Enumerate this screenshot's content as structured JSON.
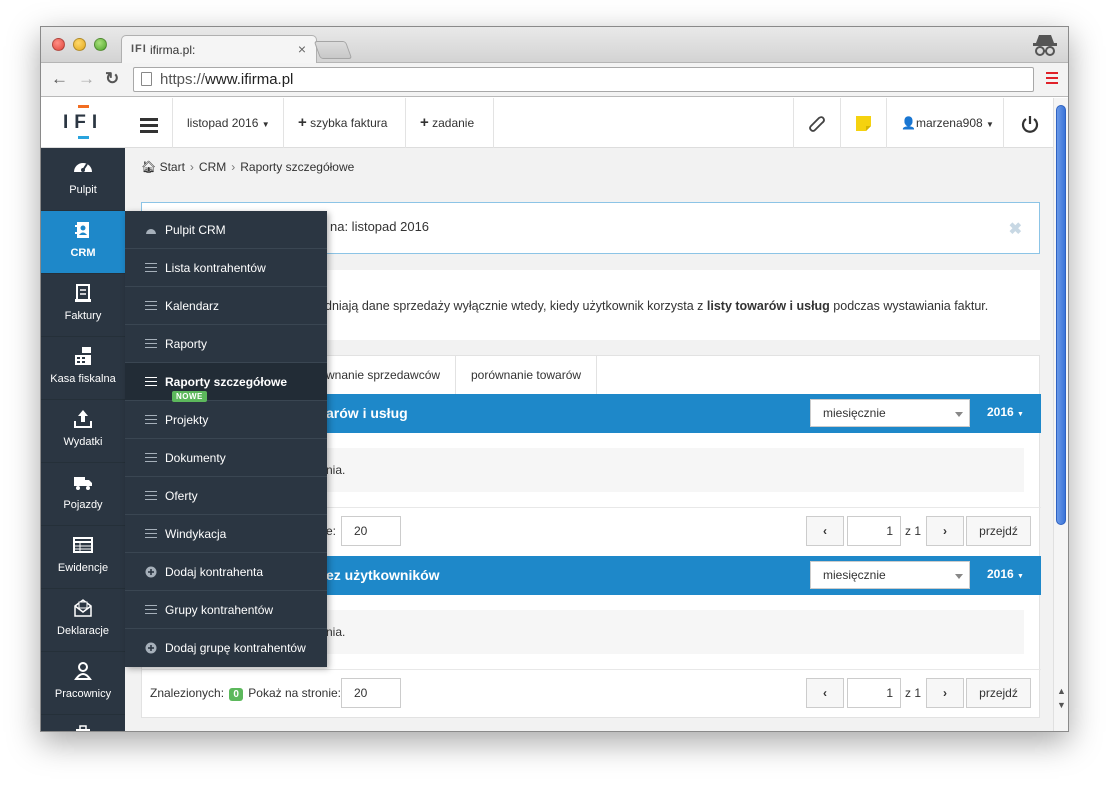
{
  "browser": {
    "tab_title": "ifirma.pl:",
    "tab_favicon": "IFI",
    "tab_close": "×",
    "url_scheme": "https://",
    "url_host": "www.ifirma.pl"
  },
  "sidebar": {
    "logo": "IFI",
    "items": [
      {
        "label": "Pulpit",
        "icon": "dashboard-icon"
      },
      {
        "label": "CRM",
        "icon": "contact-book-icon"
      },
      {
        "label": "Faktury",
        "icon": "invoice-icon"
      },
      {
        "label": "Kasa fiskalna",
        "icon": "cash-register-icon"
      },
      {
        "label": "Wydatki",
        "icon": "upload-icon"
      },
      {
        "label": "Pojazdy",
        "icon": "truck-icon"
      },
      {
        "label": "Ewidencje",
        "icon": "table-icon"
      },
      {
        "label": "Deklaracje",
        "icon": "envelope-icon"
      },
      {
        "label": "Pracownicy",
        "icon": "user-icon"
      }
    ]
  },
  "topbar": {
    "period": "listopad 2016",
    "quick_invoice": "szybka faktura",
    "task": "zadanie",
    "user": "marzena908"
  },
  "breadcrumb": {
    "start": "Start",
    "crm": "CRM",
    "current": "Raporty szczegółowe"
  },
  "alert": {
    "text": "na: listopad 2016",
    "close": "✖"
  },
  "info": {
    "text_before": "dniają dane sprzedaży wyłącznie wtedy, kiedy użytkownik korzysta z ",
    "text_bold": "listy towarów i usług",
    "text_after": " podczas wystawiania faktur."
  },
  "tabs": [
    {
      "label": "wnanie sprzedawców"
    },
    {
      "label": "porównanie towarów"
    }
  ],
  "section1": {
    "title": "arów i usług",
    "period_select": "miesięcznie",
    "year": "2016",
    "empty": "nia.",
    "perpage_prefix": "e:",
    "perpage": "20",
    "page": "1",
    "of": "z 1",
    "go": "przejdź"
  },
  "section2": {
    "title": "ez użytkowników",
    "period_select": "miesięcznie",
    "year": "2016",
    "empty": "nia.",
    "found_label": "Znalezionych:",
    "found_count": "0",
    "perpage_label": "Pokaż na stronie:",
    "perpage": "20",
    "page": "1",
    "of": "z 1",
    "go": "przejdź"
  },
  "flyout": {
    "items": [
      {
        "label": "Pulpit CRM",
        "icon": "dashboard-icon"
      },
      {
        "label": "Lista kontrahentów",
        "icon": "list-icon"
      },
      {
        "label": "Kalendarz",
        "icon": "list-icon"
      },
      {
        "label": "Raporty",
        "icon": "list-icon"
      },
      {
        "label": "Raporty szczegółowe",
        "icon": "list-icon",
        "badge": "NOWE"
      },
      {
        "label": "Projekty",
        "icon": "list-icon"
      },
      {
        "label": "Dokumenty",
        "icon": "list-icon"
      },
      {
        "label": "Oferty",
        "icon": "list-icon"
      },
      {
        "label": "Windykacja",
        "icon": "list-icon"
      },
      {
        "label": "Dodaj kontrahenta",
        "icon": "plus-circle-icon"
      },
      {
        "label": "Grupy kontrahentów",
        "icon": "list-icon"
      },
      {
        "label": "Dodaj grupę kontrahentów",
        "icon": "plus-circle-icon"
      }
    ]
  },
  "colors": {
    "accent": "#1e88c9",
    "sidebar": "#2b3642",
    "badge_green": "#5cb85c"
  }
}
